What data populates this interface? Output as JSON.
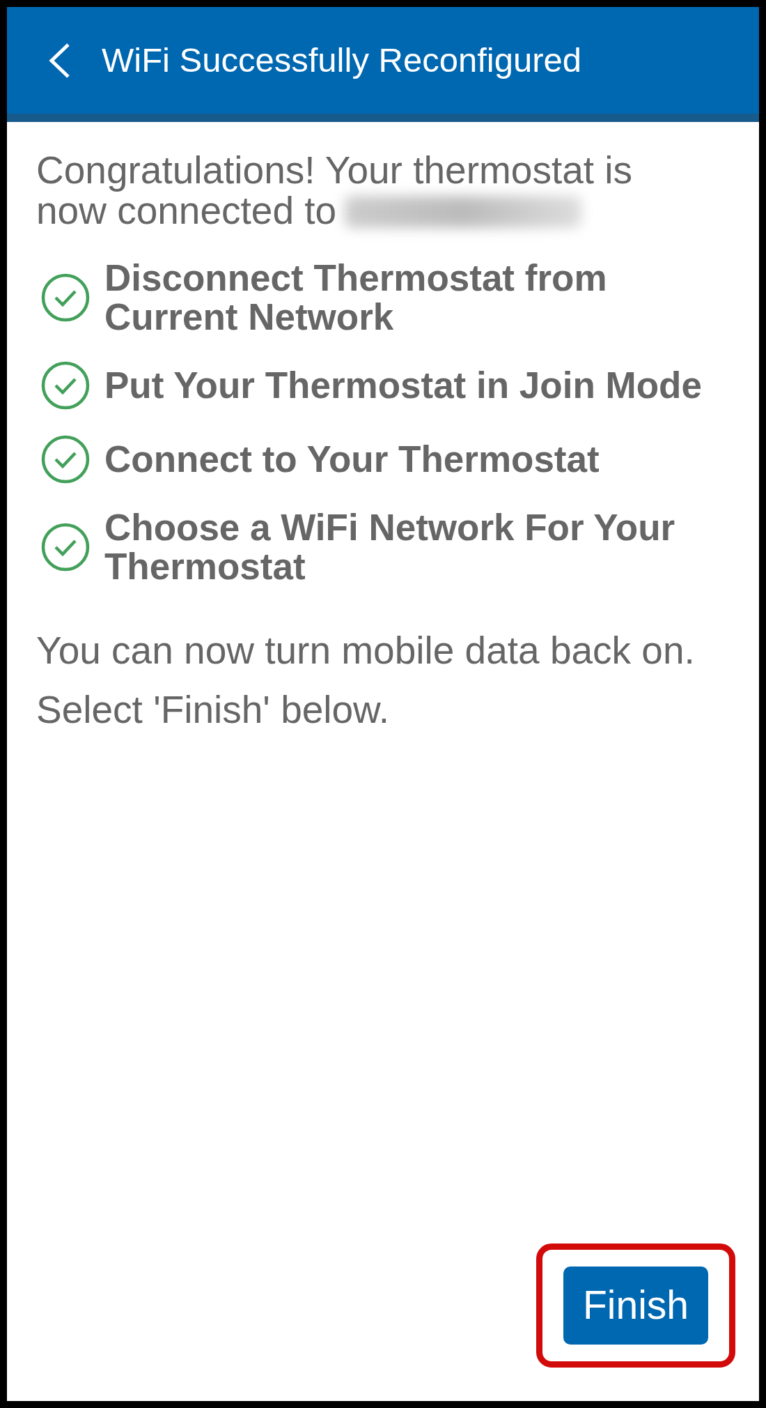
{
  "header": {
    "title": "WiFi Successfully Reconfigured"
  },
  "intro": [
    "Congratulations! Your thermostat is",
    "now connected to"
  ],
  "steps": [
    {
      "label": "Disconnect Thermostat from Current Network",
      "done": true
    },
    {
      "label": "Put Your Thermostat in Join Mode",
      "done": true
    },
    {
      "label": "Connect to Your Thermostat",
      "done": true
    },
    {
      "label": "Choose a WiFi Network For Your Thermostat",
      "done": true
    }
  ],
  "notes": [
    "You can now turn mobile data back on.",
    "Select 'Finish' below."
  ],
  "finish_button": {
    "label": "Finish",
    "highlighted": true
  }
}
